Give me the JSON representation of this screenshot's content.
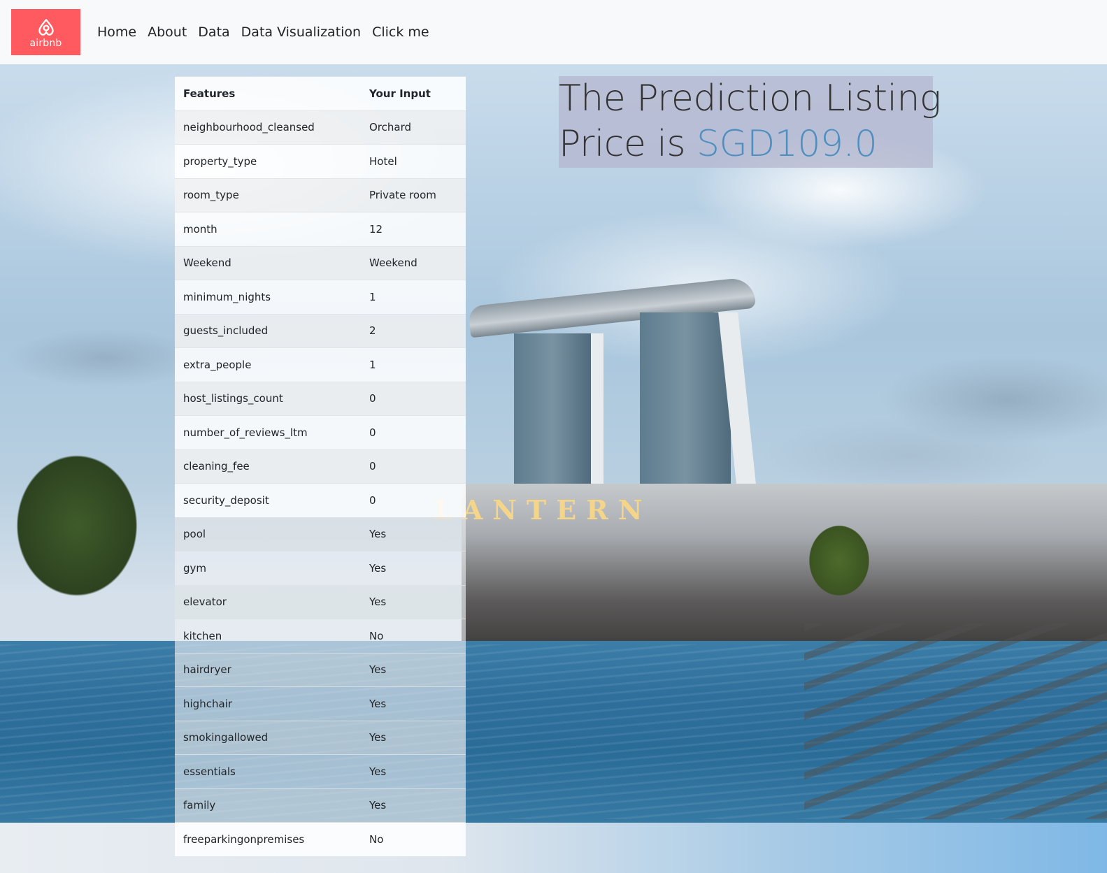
{
  "navbar": {
    "brand_text": "airbnb",
    "brand_color": "#ff5a5f",
    "links": [
      {
        "label": "Home"
      },
      {
        "label": "About"
      },
      {
        "label": "Data"
      },
      {
        "label": "Data Visualization"
      },
      {
        "label": "Click me"
      }
    ]
  },
  "table": {
    "headers": [
      "Features",
      "Your Input"
    ],
    "rows": [
      {
        "feature": "neighbourhood_cleansed",
        "value": "Orchard"
      },
      {
        "feature": "property_type",
        "value": "Hotel"
      },
      {
        "feature": "room_type",
        "value": "Private room"
      },
      {
        "feature": "month",
        "value": "12"
      },
      {
        "feature": "Weekend",
        "value": "Weekend"
      },
      {
        "feature": "minimum_nights",
        "value": "1"
      },
      {
        "feature": "guests_included",
        "value": "2"
      },
      {
        "feature": "extra_people",
        "value": "1"
      },
      {
        "feature": "host_listings_count",
        "value": "0"
      },
      {
        "feature": "number_of_reviews_ltm",
        "value": "0"
      },
      {
        "feature": "cleaning_fee",
        "value": "0"
      },
      {
        "feature": "security_deposit",
        "value": "0"
      },
      {
        "feature": "pool",
        "value": "Yes"
      },
      {
        "feature": "gym",
        "value": "Yes"
      },
      {
        "feature": "elevator",
        "value": "Yes"
      },
      {
        "feature": "kitchen",
        "value": "No"
      },
      {
        "feature": "hairdryer",
        "value": "Yes"
      },
      {
        "feature": "highchair",
        "value": "Yes"
      },
      {
        "feature": "smokingallowed",
        "value": "Yes"
      },
      {
        "feature": "essentials",
        "value": "Yes"
      },
      {
        "feature": "family",
        "value": "Yes"
      },
      {
        "feature": "freeparkingonpremises",
        "value": "No"
      }
    ]
  },
  "prediction": {
    "line1": "The Prediction Listing",
    "prefix": "Price is ",
    "price": "SGD109.0",
    "price_color": "#4f8fc0"
  },
  "background": {
    "sign_text": "LANTERN"
  }
}
